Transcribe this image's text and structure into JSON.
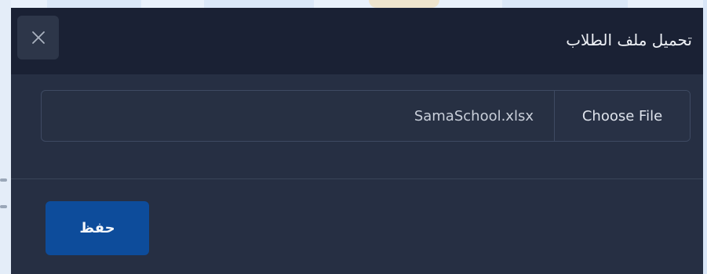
{
  "modal": {
    "title": "تحميل ملف الطلاب",
    "close_icon": "close-icon"
  },
  "file_input": {
    "file_name": "SamaSchool.xlsx",
    "choose_label": "Choose File"
  },
  "footer": {
    "save_label": "حفظ"
  },
  "colors": {
    "modal_bg": "#262f43",
    "header_bg": "#1a2134",
    "primary_button": "#0d4c9b",
    "border": "#3e4a62"
  }
}
